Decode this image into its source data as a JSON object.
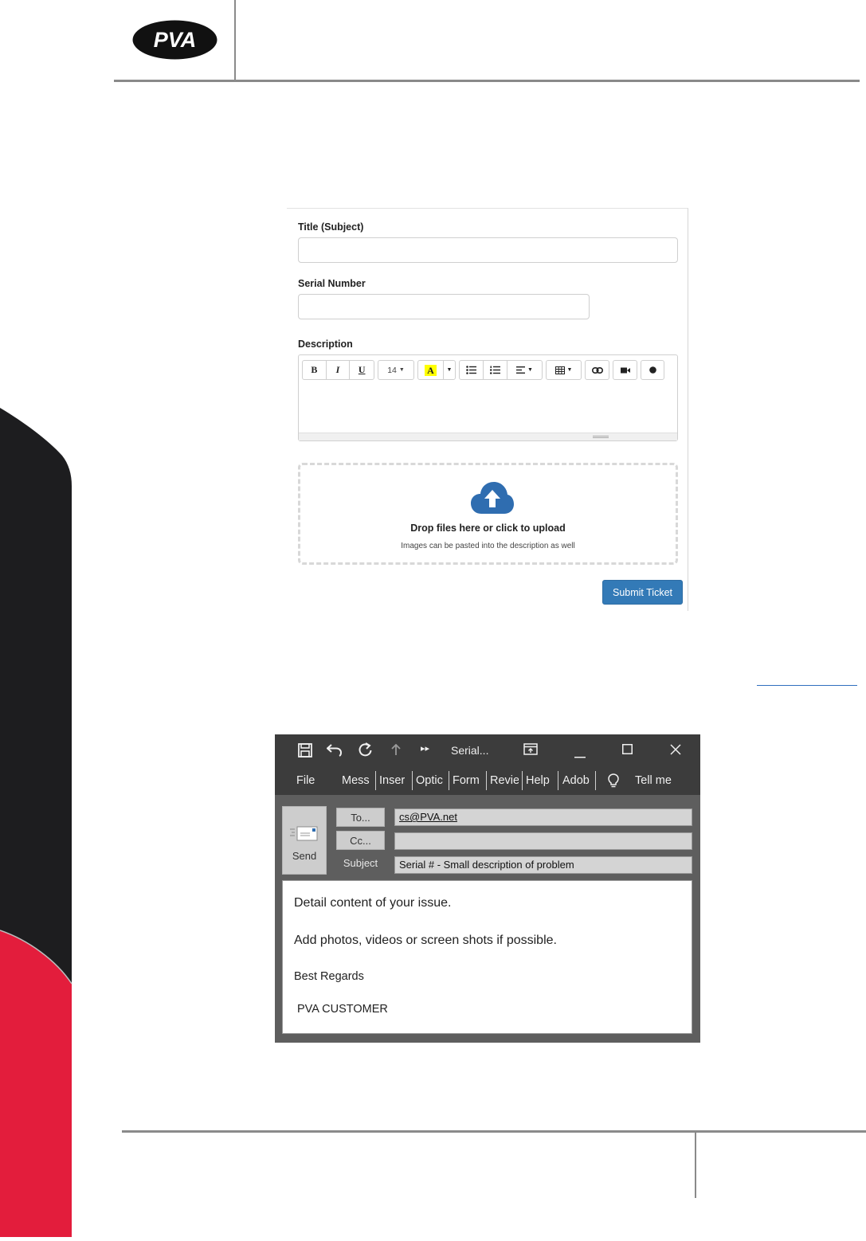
{
  "page": {
    "logo_text": "PVA",
    "colors": {
      "rule": "#8a8a8a",
      "logo_bg": "#111111",
      "deco_dark": "#1d1d1f",
      "deco_red": "#e31d3c",
      "primary_button": "#337ab7",
      "upload_icon": "#2f6db0"
    }
  },
  "ticket_form": {
    "title_label": "Title (Subject)",
    "title_value": "",
    "serial_label": "Serial Number",
    "serial_value": "",
    "description_label": "Description",
    "toolbar": {
      "bold": "B",
      "italic": "I",
      "underline": "U",
      "font_size": "14",
      "highlight": "A",
      "icons": [
        "bold-icon",
        "italic-icon",
        "underline-icon",
        "font-size-dropdown",
        "highlight-color-icon",
        "bulleted-list-icon",
        "numbered-list-icon",
        "align-icon",
        "table-icon",
        "link-icon",
        "video-icon",
        "record-icon"
      ]
    },
    "upload_title": "Drop files here or click to upload",
    "upload_subtitle": "Images can be pasted into the description as well",
    "submit_label": "Submit Ticket"
  },
  "email_window": {
    "window_title": "Serial...",
    "menu": [
      "File",
      "Mess",
      "Inser",
      "Optic",
      "Form",
      "Revie",
      "Help",
      "Adob",
      "Tell me"
    ],
    "send_label": "Send",
    "to_label": "To...",
    "cc_label": "Cc...",
    "subject_label": "Subject",
    "to_value": "cs@PVA.net",
    "cc_value": "",
    "subject_value": "Serial # - Small description of problem",
    "body_lines": [
      "Detail content of your issue.",
      "Add photos, videos or screen shots if possible.",
      "Best Regards",
      "PVA CUSTOMER"
    ]
  }
}
